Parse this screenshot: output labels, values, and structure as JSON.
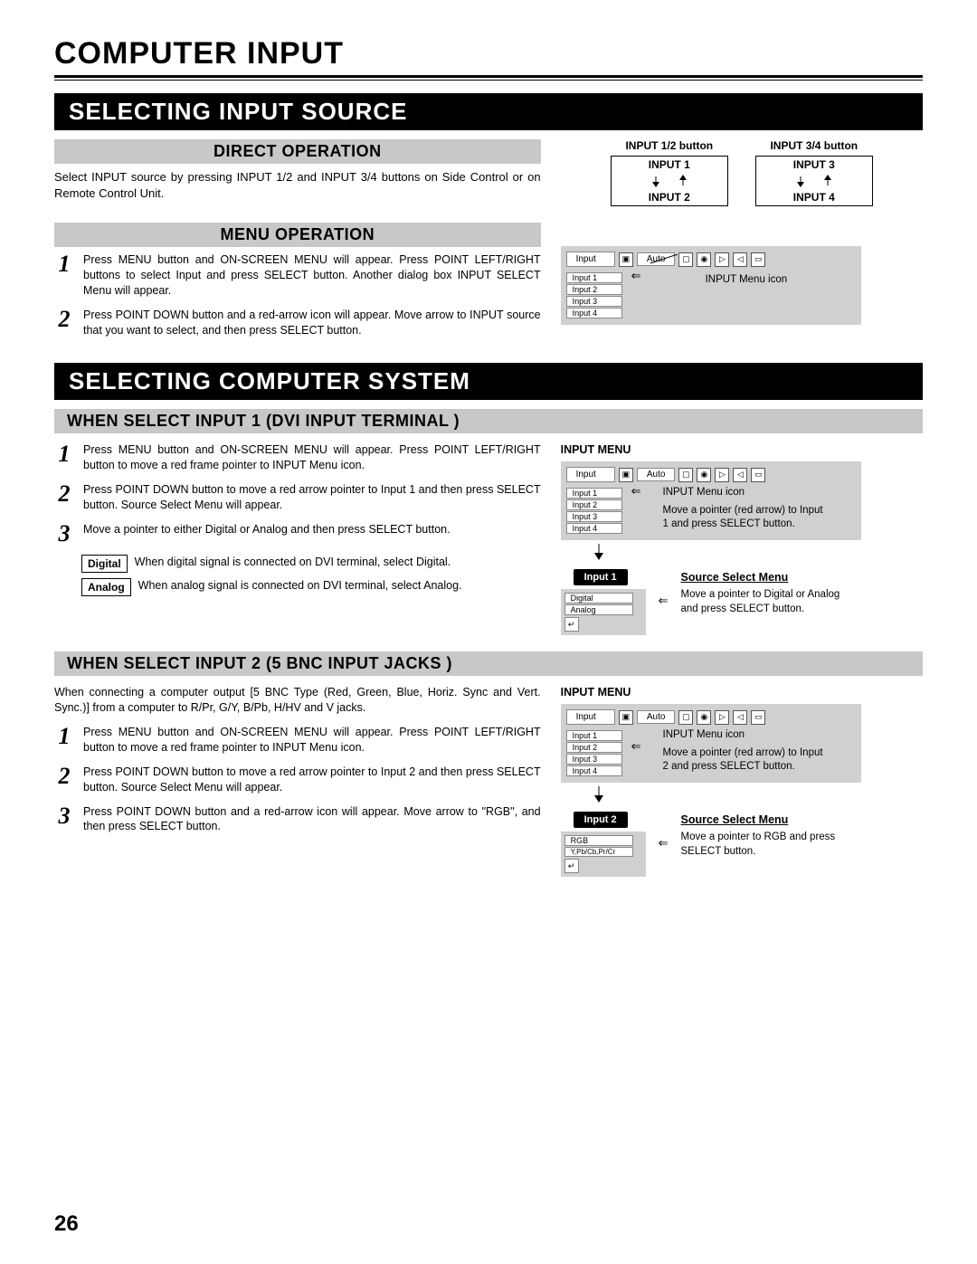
{
  "page_number": "26",
  "main_title": "COMPUTER INPUT",
  "section1": {
    "title": "SELECTING INPUT SOURCE",
    "direct_op": {
      "heading": "DIRECT OPERATION",
      "text": "Select INPUT source by pressing INPUT 1/2 and INPUT 3/4 buttons on Side Control or on Remote Control Unit.",
      "btn12_title": "INPUT 1/2 button",
      "btn12_top": "INPUT 1",
      "btn12_bot": "INPUT 2",
      "btn34_title": "INPUT 3/4 button",
      "btn34_top": "INPUT 3",
      "btn34_bot": "INPUT 4"
    },
    "menu_op": {
      "heading": "MENU OPERATION",
      "step1": "Press MENU button and ON-SCREEN MENU will appear.  Press POINT LEFT/RIGHT buttons to select Input and press SELECT button.  Another dialog box INPUT SELECT Menu will appear.",
      "step2": "Press POINT DOWN button and a red-arrow icon will appear. Move arrow to INPUT source that you want to select, and then press SELECT button.",
      "osd": {
        "label": "Input",
        "auto": "Auto",
        "items": [
          "Input 1",
          "Input 2",
          "Input 3",
          "Input 4"
        ],
        "caption": "INPUT Menu icon"
      }
    }
  },
  "section2": {
    "title": "SELECTING COMPUTER SYSTEM",
    "dvi": {
      "heading": "WHEN SELECT  INPUT 1 (DVI INPUT TERMINAL )",
      "step1": "Press MENU button and ON-SCREEN MENU will appear.  Press POINT LEFT/RIGHT button to move a red frame pointer to INPUT Menu icon.",
      "step2": "Press POINT DOWN button to move a red arrow pointer to Input 1 and then press SELECT button.  Source Select Menu will appear.",
      "step3": "Move a pointer to either Digital or Analog and then press SELECT button.",
      "digital_label": "Digital",
      "digital_text": "When digital signal is connected on DVI terminal, select Digital.",
      "analog_label": "Analog",
      "analog_text": "When analog signal is connected on DVI terminal, select Analog.",
      "menu_title": "INPUT MENU",
      "menu_caption": "INPUT Menu icon",
      "ptr_caption": "Move a pointer (red arrow) to Input 1 and press SELECT button.",
      "tab": "Input 1",
      "ss_title": "Source Select Menu",
      "ss_items": [
        "Digital",
        "Analog"
      ],
      "ss_caption": "Move a pointer to Digital or Analog and press SELECT button.",
      "osd_items": [
        "Input 1",
        "Input 2",
        "Input 3",
        "Input 4"
      ],
      "osd_label": "Input",
      "osd_auto": "Auto"
    },
    "bnc": {
      "heading": "WHEN SELECT INPUT 2 (5 BNC INPUT JACKS )",
      "intro": "When connecting a computer output [5 BNC Type (Red, Green, Blue, Horiz. Sync and Vert. Sync.)] from a computer to R/Pr, G/Y, B/Pb, H/HV and V jacks.",
      "step1": "Press MENU button and ON-SCREEN MENU will appear.  Press POINT LEFT/RIGHT button to move a red frame pointer to INPUT Menu icon.",
      "step2": "Press POINT DOWN button to move a red arrow pointer to Input 2 and then press SELECT button.  Source Select Menu will appear.",
      "step3": "Press POINT DOWN button and a red-arrow icon will appear. Move arrow to \"RGB\", and then press SELECT button.",
      "menu_title": "INPUT MENU",
      "menu_caption": "INPUT Menu icon",
      "ptr_caption": "Move a pointer (red arrow) to Input 2 and press SELECT button.",
      "tab": "Input 2",
      "ss_title": "Source Select Menu",
      "ss_items": [
        "RGB",
        "Y,Pb/Cb,Pr/Cr"
      ],
      "ss_caption": "Move a pointer to RGB and press SELECT button.",
      "osd_items": [
        "Input 1",
        "Input 2",
        "Input 3",
        "Input 4"
      ],
      "osd_label": "Input",
      "osd_auto": "Auto"
    }
  }
}
